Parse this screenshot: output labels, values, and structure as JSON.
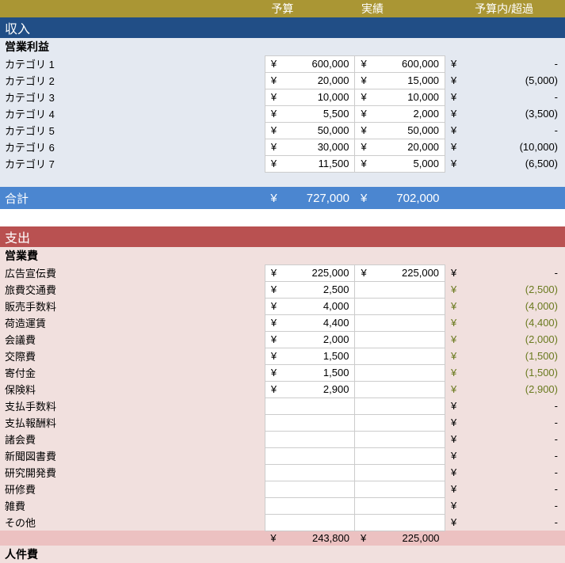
{
  "headers": {
    "budget": "予算",
    "actual": "実績",
    "variance": "予算内/超過"
  },
  "income": {
    "section": "収入",
    "group": "営業利益",
    "rows": [
      {
        "label": "カテゴリ 1",
        "b": "600,000",
        "a": "600,000",
        "v": "-",
        "neg": false
      },
      {
        "label": "カテゴリ 2",
        "b": "20,000",
        "a": "15,000",
        "v": "(5,000)",
        "neg": true
      },
      {
        "label": "カテゴリ 3",
        "b": "10,000",
        "a": "10,000",
        "v": "-",
        "neg": false
      },
      {
        "label": "カテゴリ 4",
        "b": "5,500",
        "a": "2,000",
        "v": "(3,500)",
        "neg": true
      },
      {
        "label": "カテゴリ 5",
        "b": "50,000",
        "a": "50,000",
        "v": "-",
        "neg": false
      },
      {
        "label": "カテゴリ 6",
        "b": "30,000",
        "a": "20,000",
        "v": "(10,000)",
        "neg": true
      },
      {
        "label": "カテゴリ 7",
        "b": "11,500",
        "a": "5,000",
        "v": "(6,500)",
        "neg": true
      }
    ],
    "total": {
      "label": "合計",
      "b": "727,000",
      "a": "702,000"
    }
  },
  "expense": {
    "section": "支出",
    "group": "営業費",
    "rows": [
      {
        "label": "広告宣伝費",
        "b": "225,000",
        "a": "225,000",
        "v": "-",
        "green": false
      },
      {
        "label": "旅費交通費",
        "b": "2,500",
        "a": "",
        "v": "(2,500)",
        "green": true
      },
      {
        "label": "販売手数料",
        "b": "4,000",
        "a": "",
        "v": "(4,000)",
        "green": true
      },
      {
        "label": "荷造運賃",
        "b": "4,400",
        "a": "",
        "v": "(4,400)",
        "green": true
      },
      {
        "label": "会議費",
        "b": "2,000",
        "a": "",
        "v": "(2,000)",
        "green": true
      },
      {
        "label": "交際費",
        "b": "1,500",
        "a": "",
        "v": "(1,500)",
        "green": true
      },
      {
        "label": "寄付金",
        "b": "1,500",
        "a": "",
        "v": "(1,500)",
        "green": true
      },
      {
        "label": "保険料",
        "b": "2,900",
        "a": "",
        "v": "(2,900)",
        "green": true
      },
      {
        "label": "支払手数料",
        "b": "",
        "a": "",
        "v": "-",
        "green": false
      },
      {
        "label": "支払報酬料",
        "b": "",
        "a": "",
        "v": "-",
        "green": false
      },
      {
        "label": "諸会費",
        "b": "",
        "a": "",
        "v": "-",
        "green": false
      },
      {
        "label": "新聞図書費",
        "b": "",
        "a": "",
        "v": "-",
        "green": false
      },
      {
        "label": "研究開発費",
        "b": "",
        "a": "",
        "v": "-",
        "green": false
      },
      {
        "label": "研修費",
        "b": "",
        "a": "",
        "v": "-",
        "green": false
      },
      {
        "label": "雑費",
        "b": "",
        "a": "",
        "v": "-",
        "green": false
      },
      {
        "label": "その他",
        "b": "",
        "a": "",
        "v": "-",
        "green": false
      }
    ],
    "subtotal": {
      "b": "243,800",
      "a": "225,000"
    },
    "group2": "人件費"
  },
  "yen": "¥"
}
